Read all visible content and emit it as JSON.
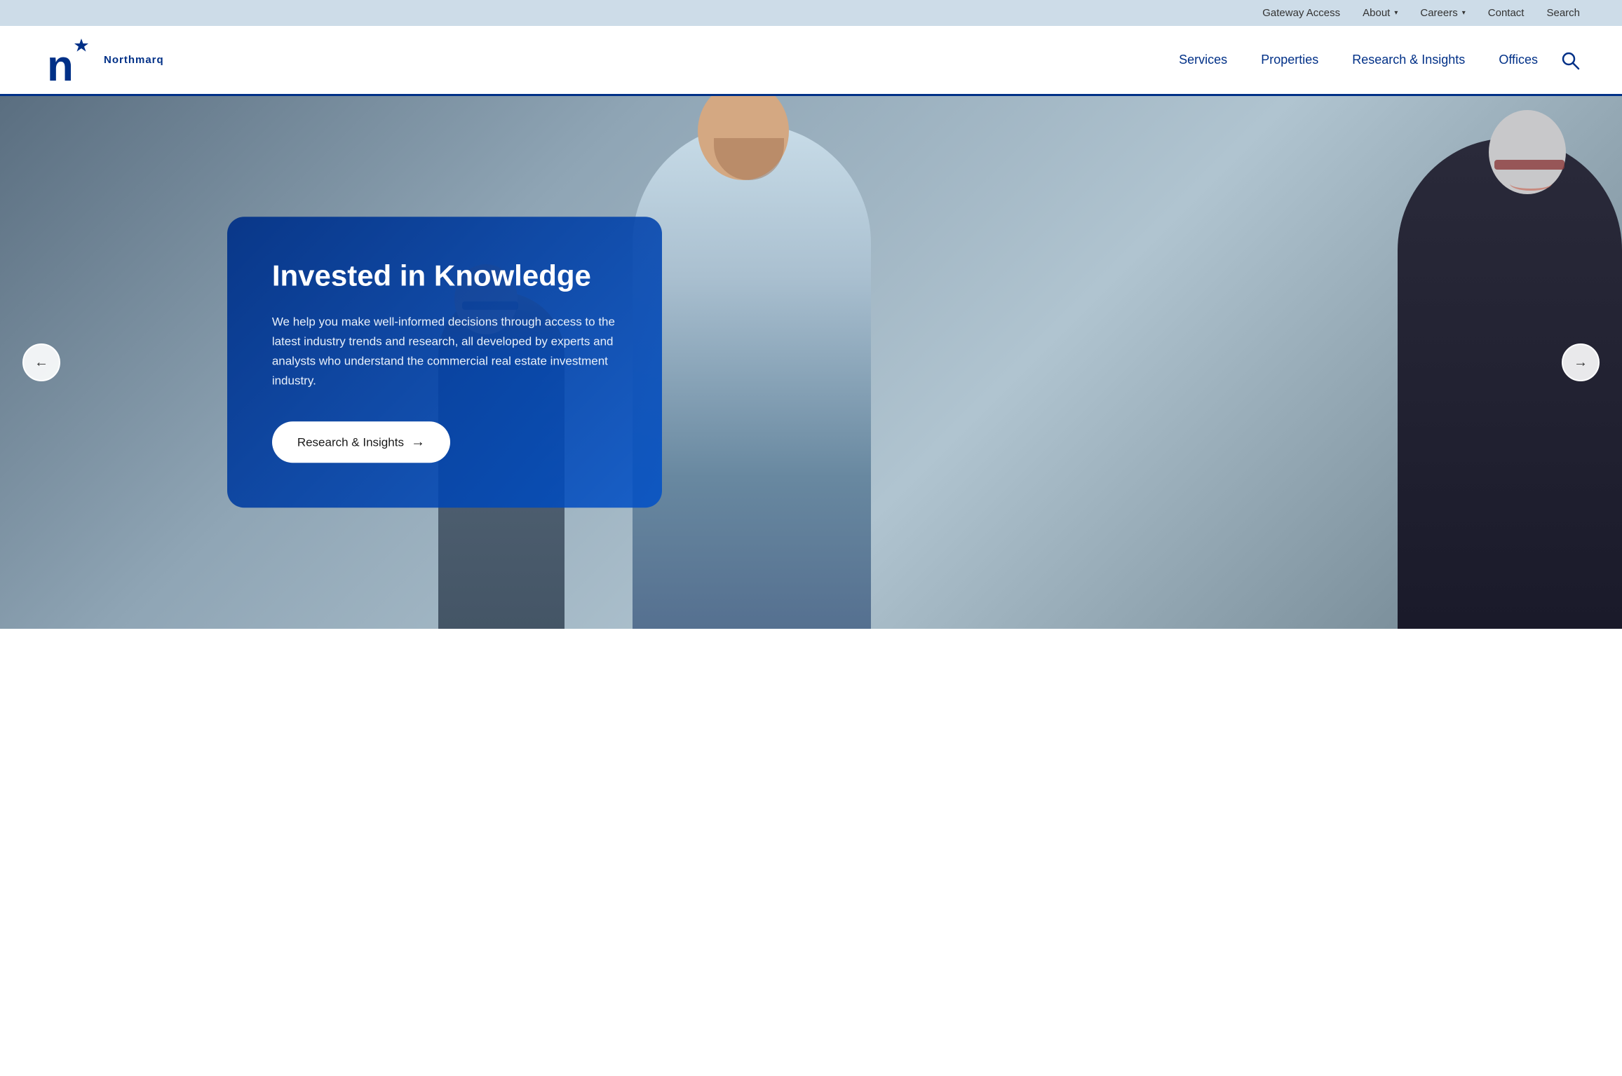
{
  "utility_bar": {
    "links": [
      {
        "id": "gateway-access",
        "label": "Gateway Access",
        "has_dropdown": false
      },
      {
        "id": "about",
        "label": "About",
        "has_dropdown": true
      },
      {
        "id": "careers",
        "label": "Careers",
        "has_dropdown": true
      },
      {
        "id": "contact",
        "label": "Contact",
        "has_dropdown": false
      },
      {
        "id": "search",
        "label": "Search",
        "has_dropdown": false
      }
    ]
  },
  "nav": {
    "logo_name": "Northmarq",
    "links": [
      {
        "id": "services",
        "label": "Services"
      },
      {
        "id": "properties",
        "label": "Properties"
      },
      {
        "id": "research",
        "label": "Research & Insights"
      },
      {
        "id": "offices",
        "label": "Offices"
      }
    ],
    "search_label": "Search"
  },
  "hero": {
    "title": "Invested in Knowledge",
    "body": "We help you make well-informed decisions through access to the latest industry trends and research, all developed by experts and analysts who understand the commercial real estate investment industry.",
    "cta_label": "Research & Insights",
    "cta_arrow": "→"
  },
  "carousel": {
    "prev_label": "←",
    "next_label": "→"
  },
  "colors": {
    "brand_blue": "#003087",
    "accent_blue": "#0050c8",
    "utility_bg": "#cddce8"
  }
}
